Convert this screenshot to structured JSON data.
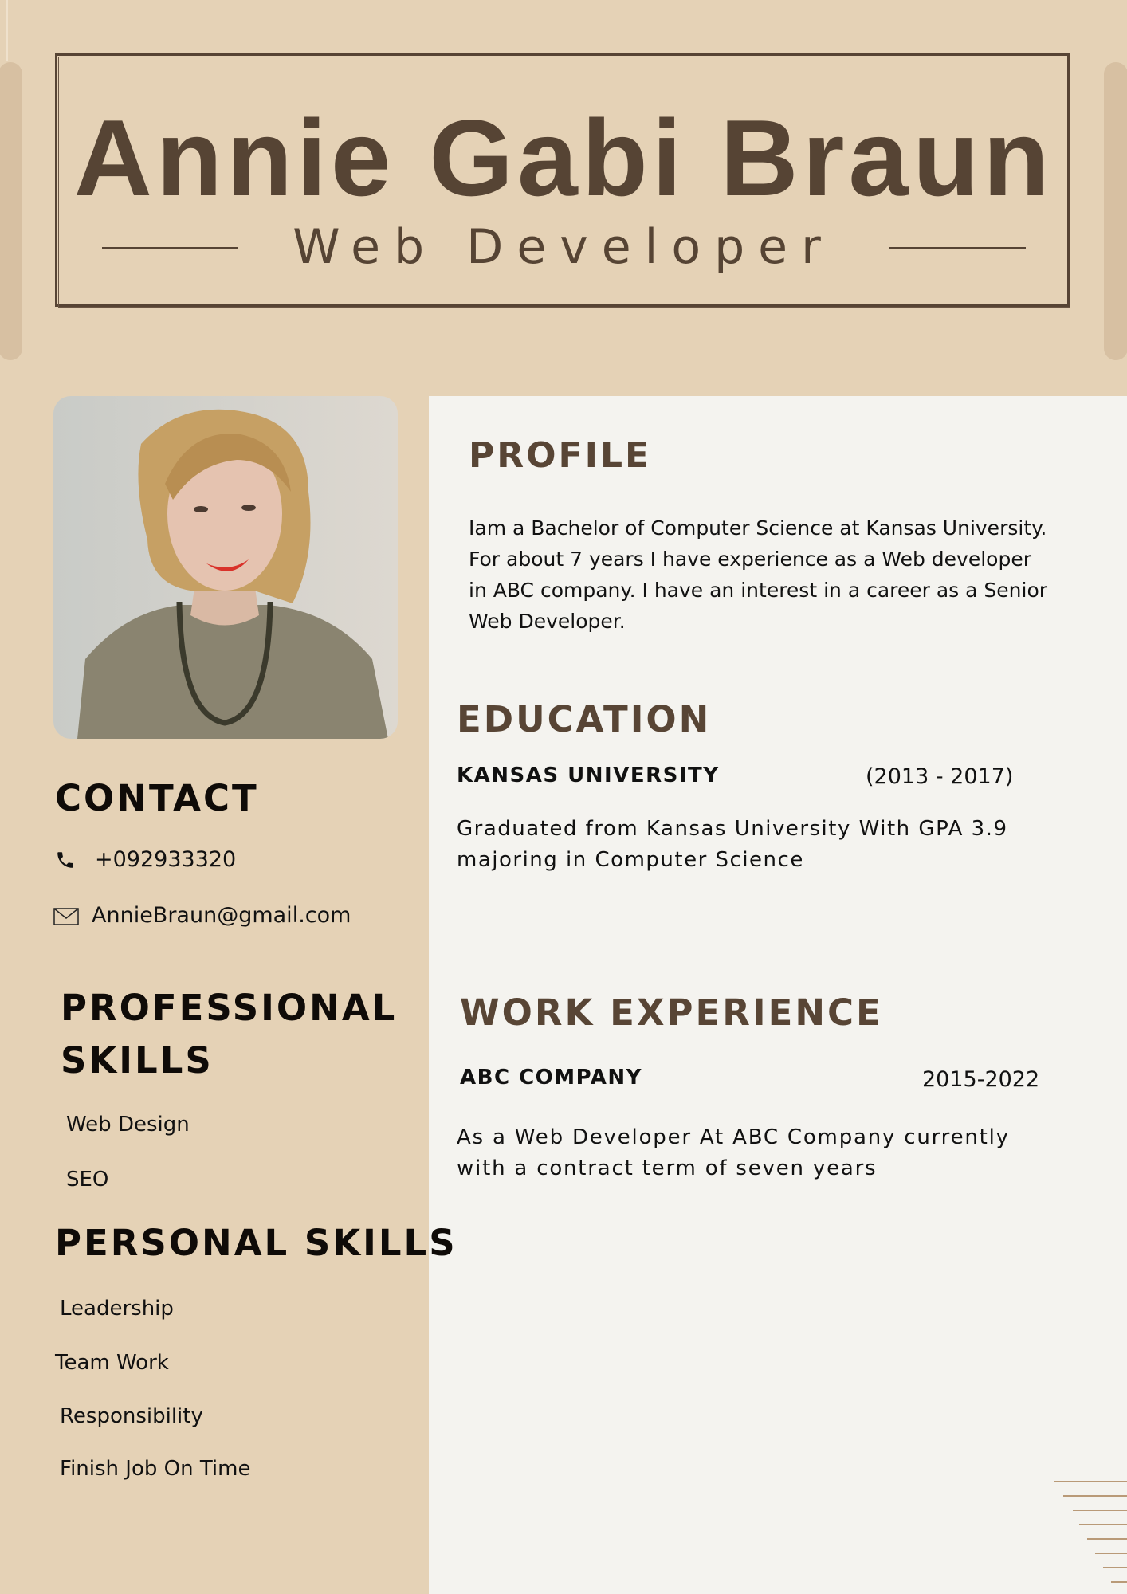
{
  "header": {
    "name": "Annie Gabi Braun",
    "role": "Web Developer"
  },
  "photo": {
    "alt": "Portrait photo"
  },
  "contact": {
    "title": "CONTACT",
    "phone": "+092933320",
    "email": "AnnieBraun@gmail.com"
  },
  "professional_skills": {
    "title_line1": "PROFESSIONAL",
    "title_line2": "SKILLS",
    "items": [
      "Web Design",
      "SEO"
    ]
  },
  "personal_skills": {
    "title": "PERSONAL SKILLS",
    "items": [
      "Leadership",
      "Team Work",
      "Responsibility",
      "Finish Job On Time"
    ]
  },
  "profile": {
    "title": "PROFILE",
    "lines": [
      "Iam a Bachelor of Computer Science at Kansas University.",
      "For about 7 years I have experience as a Web developer",
      "in ABC company. I have an interest in a career as a Senior",
      "Web Developer."
    ]
  },
  "education": {
    "title": "EDUCATION",
    "school": "KANSAS UNIVERSITY",
    "years": "(2013 - 2017)",
    "lines": [
      "Graduated from Kansas University With GPA 3.9",
      "majoring in Computer Science"
    ]
  },
  "work": {
    "title": "WORK EXPERIENCE",
    "company": "ABC COMPANY",
    "years": "2015-2022",
    "lines": [
      "As a Web Developer At ABC Company currently",
      "with a contract term of seven years"
    ]
  },
  "colors": {
    "background": "#e5d2b6",
    "panel": "#f4f3ef",
    "brown": "#564434"
  },
  "icons": [
    "phone-icon",
    "mail-icon"
  ]
}
